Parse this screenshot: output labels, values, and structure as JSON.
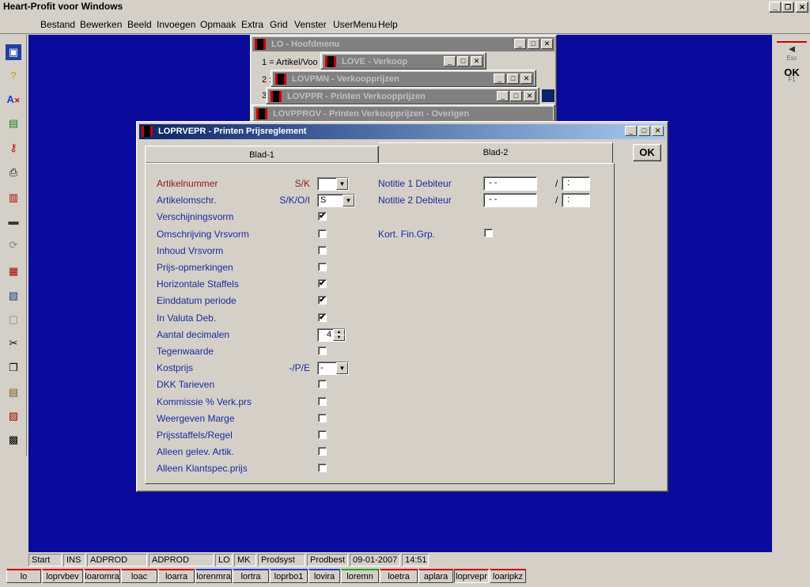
{
  "app": {
    "title": "Heart-Profit voor Windows"
  },
  "menu": [
    "Bestand",
    "Bewerken",
    "Beeld",
    "Invoegen",
    "Opmaak",
    "Extra",
    "Grid",
    "Venster",
    "UserMenu",
    "Help"
  ],
  "right_toolbar": {
    "esc_label": "Esc",
    "ok_label": "OK",
    "f1_label": "F1"
  },
  "bg_windows": {
    "hoofdmenu": {
      "title": "LO - Hoofdmenu",
      "line1": "1 = Artikel/Voo",
      "line2": "2 :",
      "line3": "3"
    },
    "verkoop": {
      "title": "LOVE - Verkoop"
    },
    "verkoopprijzen": {
      "title": "LOVPMN - Verkoopprijzen"
    },
    "printen": {
      "title": "LOVPPR - Printen Verkoopprijzen"
    },
    "overige": {
      "title": "LOVPPROV - Printen Verkoopprijzen - Overigen"
    }
  },
  "dialog": {
    "title": "LOPRVEPR - Printen Prijsreglement",
    "ok_label": "OK",
    "tabs": [
      "Blad-1",
      "Blad-2"
    ],
    "fields": [
      {
        "label": "Artikelnummer",
        "code": "S/K",
        "type": "combo",
        "value": "",
        "red": true
      },
      {
        "label": "Artikelomschr.",
        "code": "S/K/O/I",
        "type": "combo",
        "value": "S"
      },
      {
        "label": "Verschijningsvorm",
        "type": "check",
        "checked": "✔"
      },
      {
        "label": "Omschrijving Vrsvorm",
        "type": "check",
        "checked": ""
      },
      {
        "label": "Inhoud Vrsvorm",
        "type": "check",
        "checked": ""
      },
      {
        "label": "Prijs-opmerkingen",
        "type": "check",
        "checked": ""
      },
      {
        "label": "Horizontale Staffels",
        "type": "check",
        "checked": "✔"
      },
      {
        "label": "Einddatum periode",
        "type": "check",
        "checked": "✔"
      },
      {
        "label": "In Valuta Deb.",
        "type": "check",
        "checked": "✔"
      },
      {
        "label": "Aantal decimalen",
        "type": "spin",
        "value": "4"
      },
      {
        "label": "Tegenwaarde",
        "type": "check",
        "checked": ""
      },
      {
        "label": "Kostprijs",
        "code": "-/P/E",
        "type": "combo",
        "value": "-"
      },
      {
        "label": "DKK Tarieven",
        "type": "check",
        "checked": ""
      },
      {
        "label": "Kommissie % Verk.prs",
        "type": "check",
        "checked": ""
      },
      {
        "label": "Weergeven Marge",
        "type": "check",
        "checked": ""
      },
      {
        "label": "Prijsstaffels/Regel",
        "type": "check",
        "checked": ""
      },
      {
        "label": "Alleen gelev. Artik.",
        "type": "check",
        "checked": ""
      },
      {
        "label": "Alleen Klantspec.prijs",
        "type": "check",
        "checked": ""
      }
    ],
    "right": {
      "notitie1_label": "Notitie 1 Debiteur",
      "notitie1_date": "- -",
      "notitie1_time": ":",
      "notitie2_label": "Notitie 2 Debiteur",
      "notitie2_date": "- -",
      "notitie2_time": ":",
      "slash": "/",
      "kort_label": "Kort. Fin.Grp.",
      "kort_checked": ""
    }
  },
  "status": [
    "Start",
    "INS",
    "ADPROD",
    "ADPROD",
    "LO",
    "MK",
    "Prodsyst",
    "Prodbest",
    "09-01-2007",
    "14:51"
  ],
  "taskbar": [
    "lo",
    "loprvbev",
    "loaromra",
    "loac",
    "loarra",
    "lorenmra",
    "lortra",
    "loprbo1",
    "lovira",
    "loremn",
    "loetra",
    "aplara",
    "loprvepr",
    "loaripkz"
  ]
}
